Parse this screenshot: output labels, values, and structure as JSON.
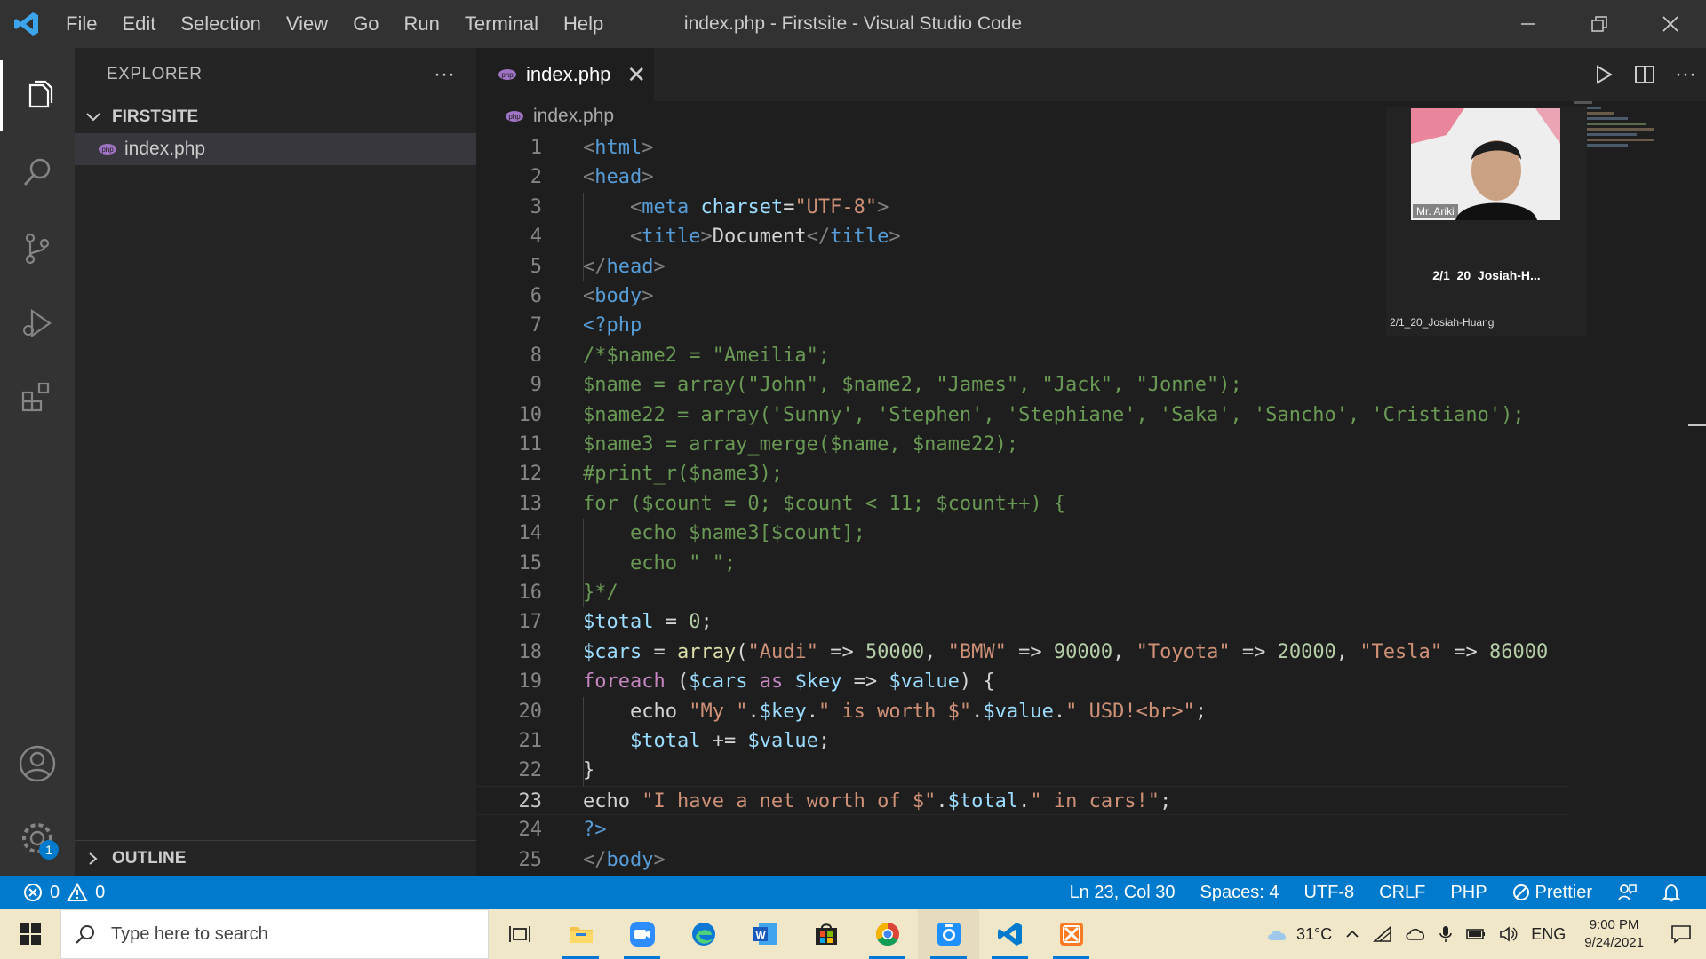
{
  "window": {
    "title": "index.php - Firstsite - Visual Studio Code"
  },
  "menu": [
    "File",
    "Edit",
    "Selection",
    "View",
    "Go",
    "Run",
    "Terminal",
    "Help"
  ],
  "sidebar": {
    "title": "EXPLORER",
    "folder": "FIRSTSITE",
    "files": [
      "index.php"
    ],
    "outline": "OUTLINE"
  },
  "settings_badge": "1",
  "tab": {
    "label": "index.php"
  },
  "breadcrumb": "index.php",
  "editor": {
    "current_line": 23,
    "lines": [
      "<html>",
      "<head>",
      "    <meta charset=\"UTF-8\">",
      "    <title>Document</title>",
      "</head>",
      "<body>",
      "<?php",
      "/*$name2 = \"Ameilia\";",
      "$name = array(\"John\", $name2, \"James\", \"Jack\", \"Jonne\");",
      "$name22 = array('Sunny', 'Stephen', 'Stephiane', 'Saka', 'Sancho', 'Cristiano');",
      "$name3 = array_merge($name, $name22);",
      "#print_r($name3);",
      "for ($count = 0; $count < 11; $count++) {",
      "    echo $name3[$count];",
      "    echo \" \";",
      "}*/",
      "$total = 0;",
      "$cars = array(\"Audi\" => 50000, \"BMW\" => 90000, \"Toyota\" => 20000, \"Tesla\" => 86000",
      "foreach ($cars as $key => $value) {",
      "    echo \"My \".$key.\" is worth $\".$value.\" USD!<br>\";",
      "    $total += $value;",
      "}",
      "echo \"I have a net worth of $\".$total.\" in cars!\";",
      "?>",
      "</body>"
    ]
  },
  "video": {
    "name_tag": "Mr. Ariki",
    "title": "2/1_20_Josiah-H...",
    "subtitle": "2/1_20_Josiah-Huang"
  },
  "status": {
    "errors": "0",
    "warnings": "0",
    "position": "Ln 23, Col 30",
    "spaces": "Spaces: 4",
    "encoding": "UTF-8",
    "eol": "CRLF",
    "language": "PHP",
    "formatter": "Prettier"
  },
  "taskbar": {
    "search_placeholder": "Type here to search",
    "temperature": "31°C",
    "language": "ENG",
    "time": "9:00 PM",
    "date": "9/24/2021"
  },
  "colors": {
    "accent": "#007acc",
    "php_icon": "#a074c4",
    "tag": "#569cd6",
    "attr": "#9cdcfe",
    "string": "#ce9178",
    "comment": "#6a9955",
    "number": "#b5cea8",
    "keyword": "#c586c0",
    "function": "#dcdcaa"
  }
}
